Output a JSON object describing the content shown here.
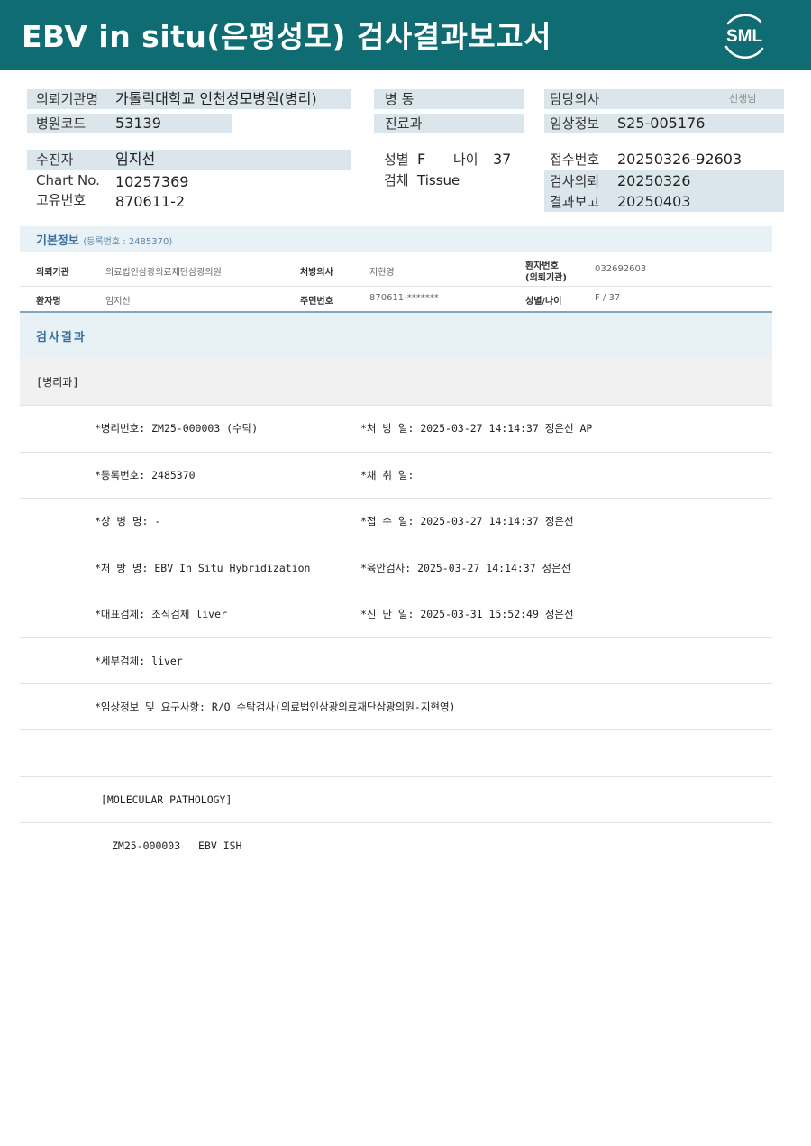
{
  "header": {
    "title": "EBV in situ(은평성모) 검사결과보고서",
    "logo_text": "SML"
  },
  "info": {
    "institution_label": "의뢰기관명",
    "institution_value": "가톨릭대학교 인천성모병원(병리)",
    "hospital_code_label": "병원코드",
    "hospital_code_value": "53139",
    "ward_label": "병 동",
    "dept_label": "진료과",
    "doctor_label": "담당의사",
    "doctor_suffix": "선생님",
    "clinical_label": "임상정보",
    "clinical_value": "S25-005176",
    "patient_label": "수진자",
    "patient_value": "임지선",
    "chart_label": "Chart No.",
    "chart_value": "10257369",
    "unique_label": "고유번호",
    "unique_value": "870611-2",
    "sex_label": "성별",
    "sex_value": "F",
    "age_label": "나이",
    "age_value": "37",
    "specimen_label": "검체",
    "specimen_value": "Tissue",
    "receipt_label": "접수번호",
    "receipt_value": "20250326-92603",
    "request_label": "검사의뢰",
    "request_value": "20250326",
    "report_label": "결과보고",
    "report_value": "20250403"
  },
  "basic": {
    "title": "기본정보",
    "reg": "(등록번호 : 2485370)",
    "rows": [
      {
        "k1": "의뢰기관",
        "v1": "의료법인삼광의료재단삼광의원",
        "k2": "처방의사",
        "v2": "지현영",
        "k3a": "환자번호",
        "k3b": "(의뢰기관)",
        "v3": "032692603"
      },
      {
        "k1": "환자명",
        "v1": "임지선",
        "k2": "주민번호",
        "v2": "870611-*******",
        "k3a": "성별/나이",
        "k3b": "",
        "v3": "F / 37"
      }
    ]
  },
  "results": {
    "title": "검사결과",
    "dept": "[병리과]",
    "rows": [
      {
        "left": "*병리번호: ZM25-000003 (수탁)",
        "right": "*처 방 일: 2025-03-27 14:14:37  정은선 AP"
      },
      {
        "left": "*등록번호: 2485370",
        "right": "*채 취 일:"
      },
      {
        "left": "*상 병 명: -",
        "right": "*접 수 일: 2025-03-27 14:14:37  정은선"
      },
      {
        "left": "*처 방 명: EBV In Situ Hybridization",
        "right": "*육안검사: 2025-03-27 14:14:37  정은선"
      },
      {
        "left": "*대표검체: 조직검체 liver",
        "right": "*진 단 일: 2025-03-31 15:52:49  정은선"
      },
      {
        "left": "*세부검체: liver",
        "right": ""
      },
      {
        "left": "*임상정보 및 요구사항: R/O 수탁검사(의료법인삼광의료재단삼광의원-지현영)",
        "right": ""
      }
    ],
    "molecular": "[MOLECULAR PATHOLOGY]",
    "mol_code": "ZM25-000003",
    "mol_test": "EBV ISH"
  },
  "colors": {
    "header_bg": "#0f6c73",
    "label_bg": "#dbe6ec",
    "section_title": "#3a6f9f"
  }
}
